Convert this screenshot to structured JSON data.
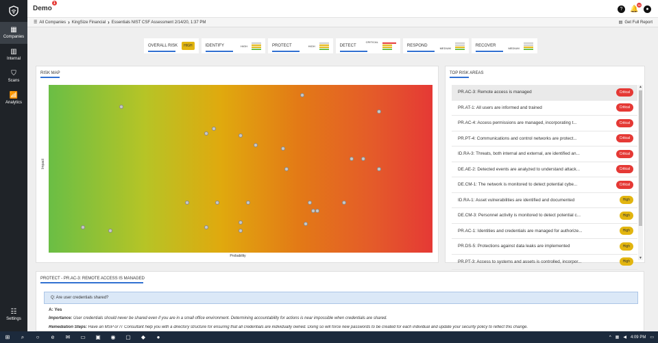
{
  "app": {
    "title": "Demo",
    "notif_count": "1",
    "bell_count": "38"
  },
  "sidebar": {
    "items": [
      {
        "label": "Companies"
      },
      {
        "label": "Internal"
      },
      {
        "label": "Scans"
      },
      {
        "label": "Analytics"
      }
    ],
    "settings_label": "Settings"
  },
  "breadcrumb": {
    "all": "All Companies",
    "company": "KingSize Financial",
    "assessment": "Essentials NIST CSF Assessment 2/14/20, 1:37 PM"
  },
  "report_label": "Get Full Report",
  "scores": {
    "overall_label": "OVERALL RISK",
    "overall_value": "HIGH",
    "identify_label": "IDENTIFY",
    "identify_level": "HIGH",
    "protect_label": "PROTECT",
    "protect_level": "HIGH",
    "detect_label": "DETECT",
    "detect_level": "CRITICAL",
    "respond_label": "RESPOND",
    "respond_level": "MEDIUM",
    "recover_label": "RECOVER",
    "recover_level": "MEDIUM"
  },
  "riskmap": {
    "title": "RISK MAP",
    "xlabel": "Probability",
    "ylabel": "Impact",
    "points": [
      {
        "p": 0.19,
        "i": 0.87
      },
      {
        "p": 0.66,
        "i": 0.94
      },
      {
        "p": 0.86,
        "i": 0.84
      },
      {
        "p": 0.41,
        "i": 0.71
      },
      {
        "p": 0.43,
        "i": 0.74
      },
      {
        "p": 0.5,
        "i": 0.7
      },
      {
        "p": 0.54,
        "i": 0.64
      },
      {
        "p": 0.61,
        "i": 0.62
      },
      {
        "p": 0.79,
        "i": 0.56
      },
      {
        "p": 0.82,
        "i": 0.56
      },
      {
        "p": 0.62,
        "i": 0.5
      },
      {
        "p": 0.86,
        "i": 0.5
      },
      {
        "p": 0.36,
        "i": 0.3
      },
      {
        "p": 0.44,
        "i": 0.3
      },
      {
        "p": 0.52,
        "i": 0.3
      },
      {
        "p": 0.68,
        "i": 0.3
      },
      {
        "p": 0.77,
        "i": 0.3
      },
      {
        "p": 0.69,
        "i": 0.25
      },
      {
        "p": 0.7,
        "i": 0.25
      },
      {
        "p": 0.5,
        "i": 0.18
      },
      {
        "p": 0.67,
        "i": 0.17
      },
      {
        "p": 0.41,
        "i": 0.15
      },
      {
        "p": 0.5,
        "i": 0.13
      },
      {
        "p": 0.09,
        "i": 0.15
      },
      {
        "p": 0.16,
        "i": 0.13
      }
    ]
  },
  "toprisk": {
    "title": "TOP RISK AREAS",
    "items": [
      {
        "text": "PR.AC-3: Remote access is managed",
        "level": "Critical"
      },
      {
        "text": "PR.AT-1: All users are informed and trained",
        "level": "Critical"
      },
      {
        "text": "PR.AC-4: Access permissions are managed, incorporating t...",
        "level": "Critical"
      },
      {
        "text": "PR.PT-4: Communications and control networks are protect...",
        "level": "Critical"
      },
      {
        "text": "ID.RA-3: Threats, both internal and external, are identified an...",
        "level": "Critical"
      },
      {
        "text": "DE.AE-2: Detected events are analyzed to understand attack...",
        "level": "Critical"
      },
      {
        "text": "DE.CM-1: The network is monitored to detect potential cybe...",
        "level": "Critical"
      },
      {
        "text": "ID.RA-1: Asset vulnerabilities are identified and documented",
        "level": "High"
      },
      {
        "text": "DE.CM-3: Personnel activity is monitored to detect potential c...",
        "level": "High"
      },
      {
        "text": "PR.AC-1: Identities and credentials are managed for authorize...",
        "level": "High"
      },
      {
        "text": "PR.DS-5: Protections against data leaks are implemented",
        "level": "High"
      },
      {
        "text": "PR.PT-3: Access to systems and assets is controlled, incorpor...",
        "level": "High"
      }
    ]
  },
  "detail": {
    "title": "PROTECT - PR.AC-3: REMOTE ACCESS IS MANAGED",
    "question": "Q: Are user credentials shared?",
    "answer": "A: Yes",
    "importance_label": "Importance:",
    "importance_text": " User credentials should never be shared even if you are in a small office environment.  Determining accountability for actions is near impossible when credentials are shared.",
    "remediation_label": "Remediation Steps:",
    "remediation_text": " Have an MSP or IT Consultant help you with a directory structure for ensuring that all credentials are individually owned.  Doing so will force new passwords to be created for each individual and update your security policy to reflect this change."
  },
  "taskbar": {
    "time": "4:09 PM"
  }
}
